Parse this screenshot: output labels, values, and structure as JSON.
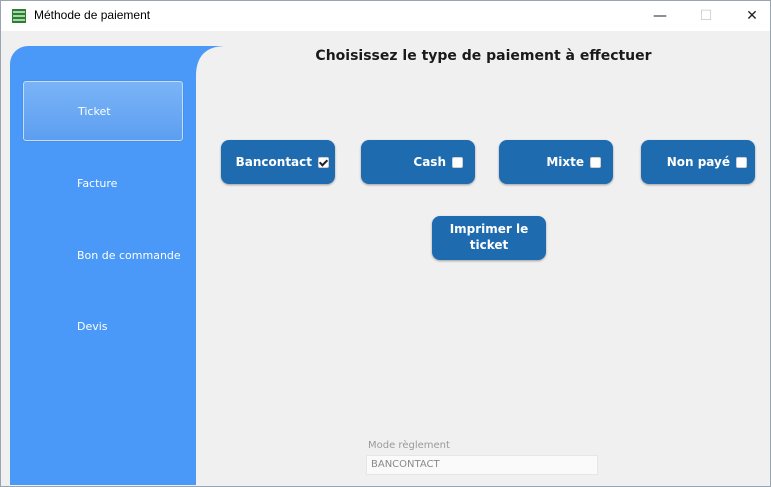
{
  "window": {
    "title": "Méthode de paiement",
    "minimize": "—",
    "maximize": "☐",
    "close": "✕"
  },
  "sidebar": {
    "items": [
      {
        "label": "Ticket",
        "active": true
      },
      {
        "label": "Facture",
        "active": false
      },
      {
        "label": "Bon de commande",
        "active": false
      },
      {
        "label": "Devis",
        "active": false
      }
    ]
  },
  "main": {
    "heading": "Choisissez le type de paiement à effectuer",
    "payment_options": [
      {
        "label": "Bancontact",
        "checked": true
      },
      {
        "label": "Cash",
        "checked": false
      },
      {
        "label": "Mixte",
        "checked": false
      },
      {
        "label": "Non payé",
        "checked": false
      }
    ],
    "print_button": {
      "line1": "Imprimer le",
      "line2": "ticket"
    },
    "mode_reglement": {
      "label": "Mode règlement",
      "value": "BANCONTACT"
    }
  },
  "colors": {
    "sidebar": "#4a98f7",
    "button": "#1f6bb0",
    "background": "#f0f0f0"
  }
}
